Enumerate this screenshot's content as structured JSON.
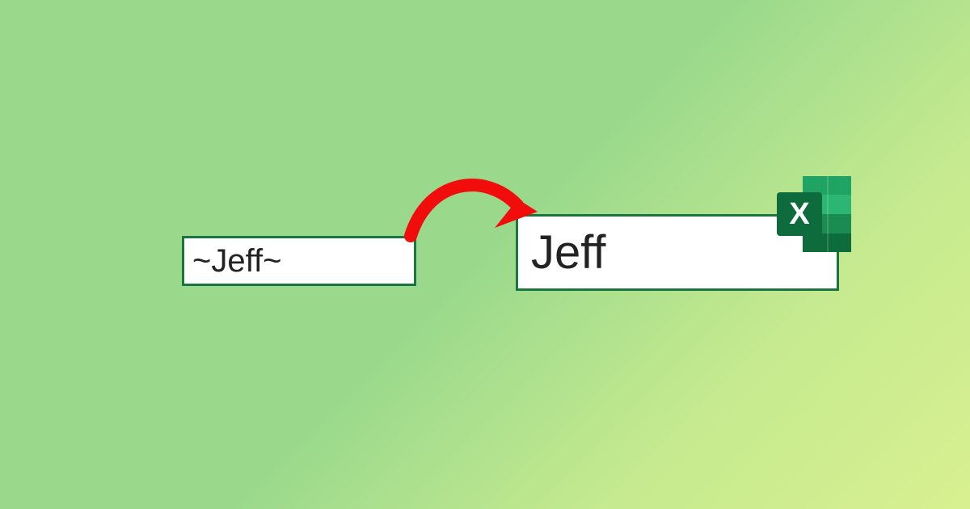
{
  "cells": {
    "left_value": "~Jeff~",
    "right_value": "Jeff"
  },
  "icon": {
    "name": "excel-icon",
    "letter": "X"
  },
  "colors": {
    "cell_border": "#1a7540",
    "arrow": "#f20d0d",
    "excel_dark": "#0e6b3c",
    "excel_mid": "#1a8c52",
    "excel_light": "#2bb673"
  }
}
